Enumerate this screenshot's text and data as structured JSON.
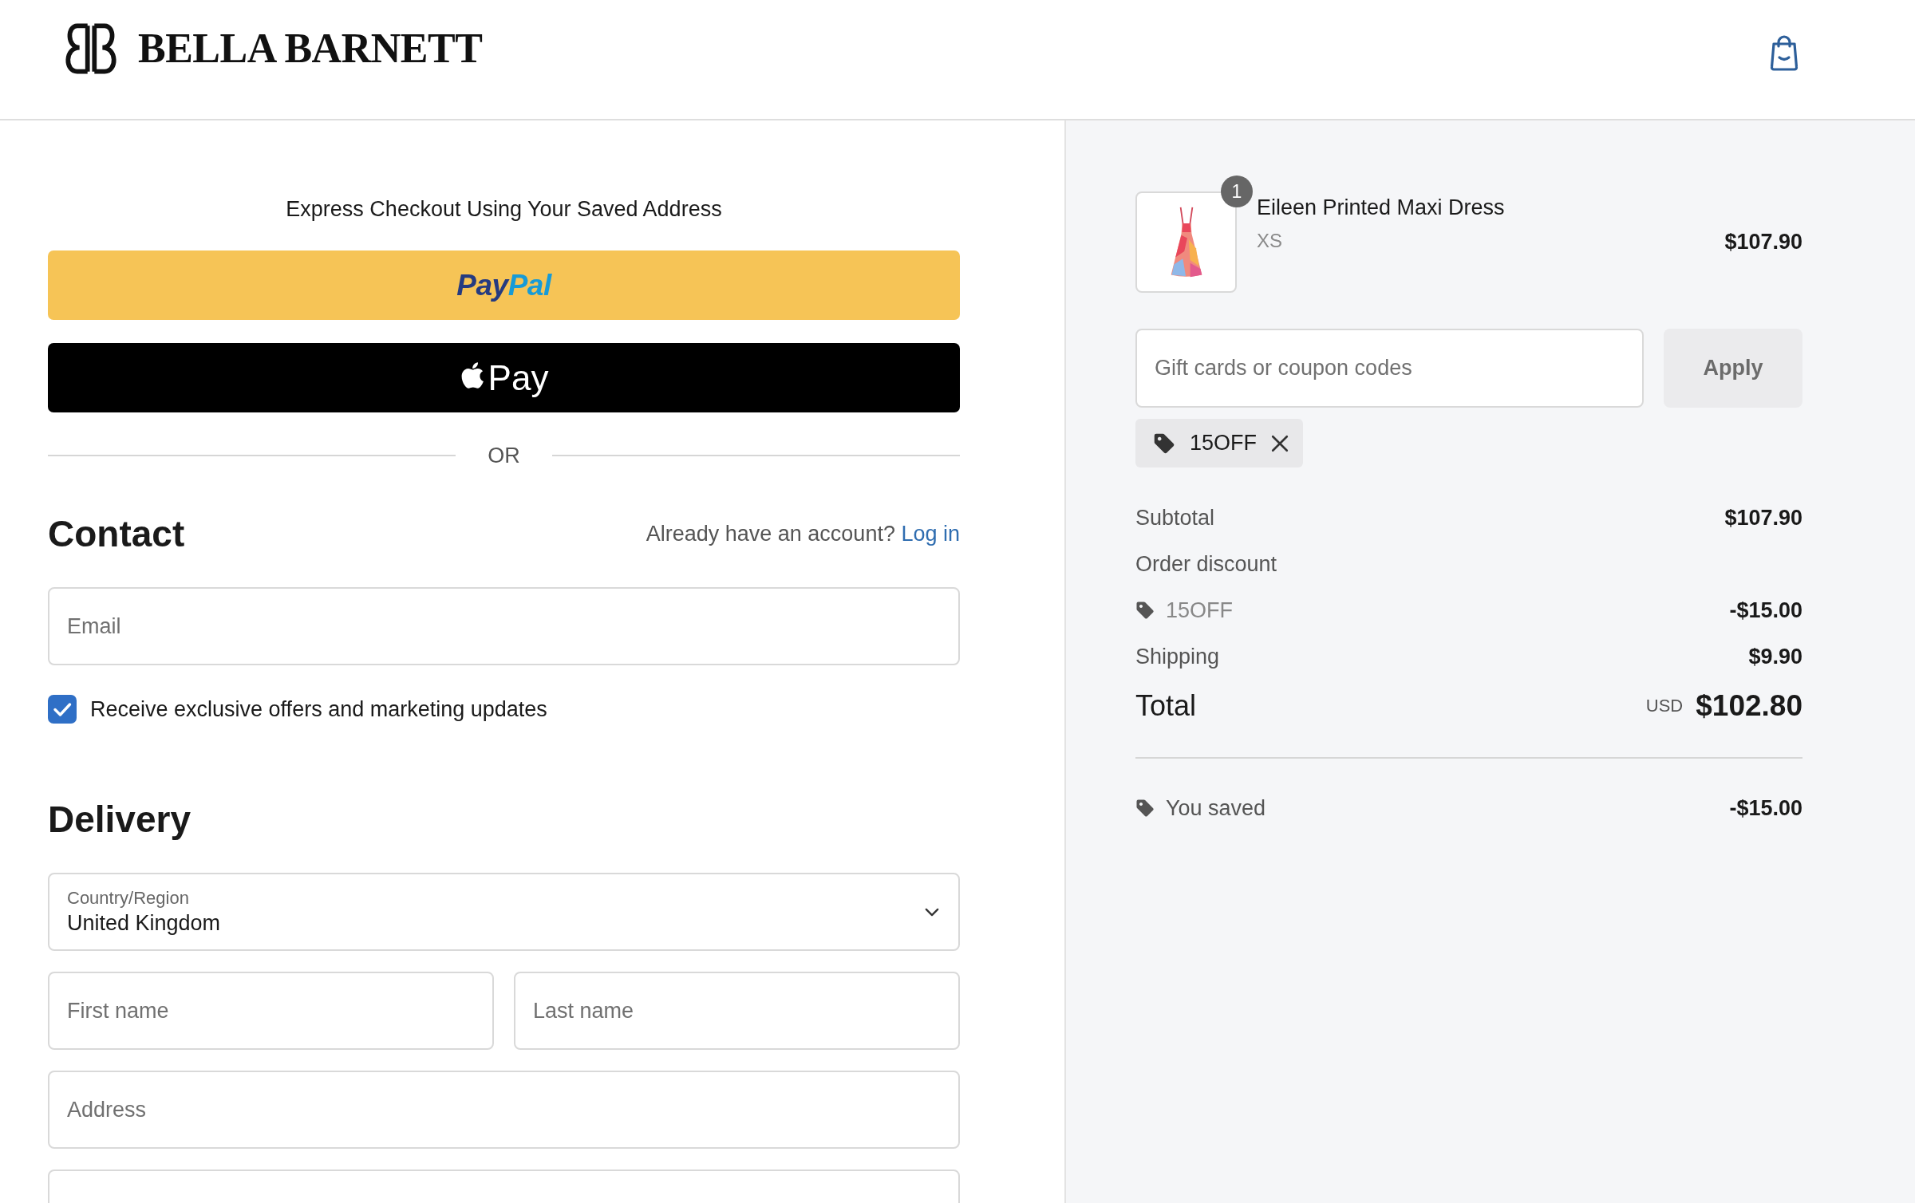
{
  "header": {
    "brand": "BELLA BARNETT"
  },
  "express_checkout": {
    "title": "Express Checkout Using Your Saved Address",
    "buttons": [
      {
        "kind": "paypal",
        "label_parts": [
          "Pay",
          "Pal"
        ]
      },
      {
        "kind": "apple_pay",
        "label": "Pay"
      }
    ],
    "divider": "OR"
  },
  "contact": {
    "heading": "Contact",
    "account_prompt": "Already have an account?",
    "login_link": "Log in",
    "email": {
      "placeholder": "Email"
    },
    "marketing_opt_in": {
      "label": "Receive exclusive offers and marketing updates",
      "checked": true
    }
  },
  "delivery": {
    "heading": "Delivery",
    "rows": [
      [
        {
          "kind": "select",
          "label": "Country/Region",
          "value": "United Kingdom"
        }
      ],
      [
        {
          "kind": "text",
          "placeholder": "First name"
        },
        {
          "kind": "text",
          "placeholder": "Last name"
        }
      ],
      [
        {
          "kind": "text",
          "placeholder": "Address"
        }
      ],
      [
        {
          "kind": "text"
        }
      ]
    ]
  },
  "order_summary": {
    "items": [
      {
        "name": "Eileen Printed Maxi Dress",
        "variant": "XS",
        "quantity": "1",
        "price": "$107.90"
      }
    ],
    "discount_field": {
      "placeholder": "Gift cards or coupon codes"
    },
    "apply_button": "Apply",
    "applied_codes": [
      "15OFF"
    ],
    "lines": [
      {
        "kind": "subtotal",
        "label": "Subtotal",
        "value": "$107.90"
      },
      {
        "kind": "heading",
        "label": "Order discount"
      },
      {
        "kind": "code",
        "label": "15OFF",
        "value": "-$15.00"
      },
      {
        "kind": "shipping",
        "label": "Shipping",
        "value": "$9.90"
      },
      {
        "kind": "total",
        "label": "Total",
        "currency": "USD",
        "value": "$102.80"
      }
    ],
    "savings": {
      "label": "You saved",
      "value": "-$15.00"
    }
  }
}
